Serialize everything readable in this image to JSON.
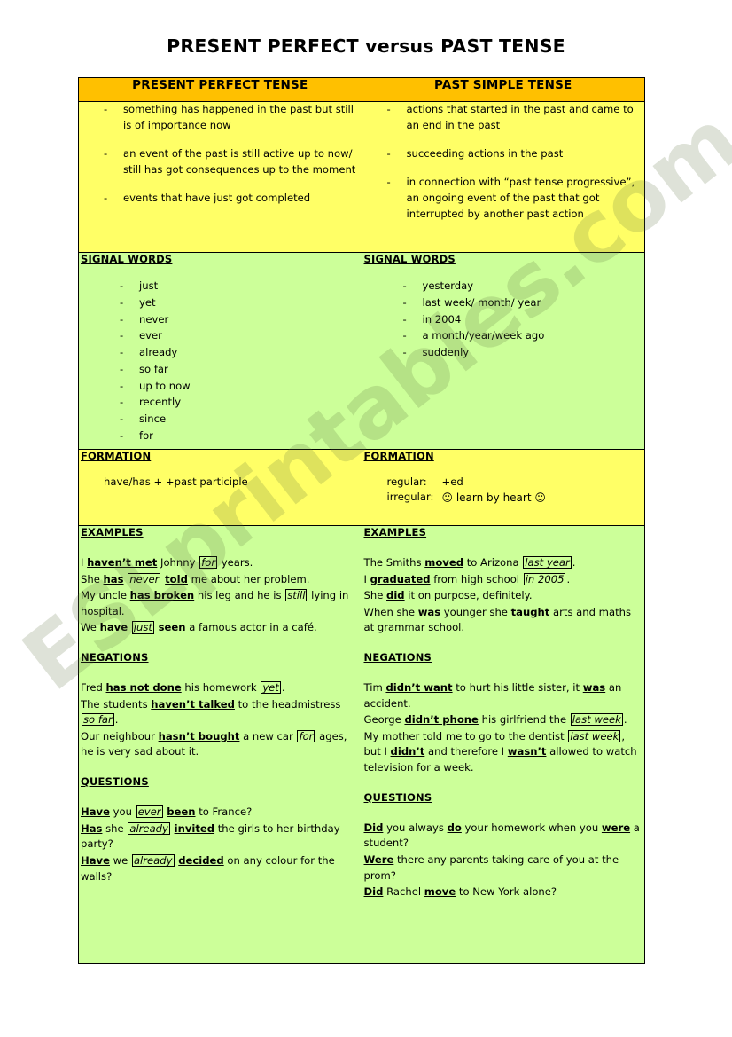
{
  "page_title": "PRESENT PERFECT versus PAST TENSE",
  "watermark": "ESLprintables.com",
  "colors": {
    "header_orange": "#FFC000",
    "row_yellow": "#FFFF66",
    "row_green": "#CCFF99",
    "border": "#000000"
  },
  "table": {
    "headers": {
      "left": "PRESENT PERFECT TENSE",
      "right": "PAST SIMPLE TENSE"
    },
    "definitions": {
      "left": [
        "something has happened in the past but still is of importance now",
        "an event of the past is still active up to now/ still has got consequences up to the moment",
        "events that have just got completed"
      ],
      "right": [
        "actions that started in the past and came to an end in the past",
        "succeeding actions in the past",
        "in connection with “past tense progressive”, an ongoing event of the past that got interrupted by another past action"
      ]
    },
    "signal_words": {
      "heading": "SIGNAL WORDS",
      "left": [
        "just",
        "yet",
        "never",
        "ever",
        "already",
        "so far",
        "up to now",
        "recently",
        "since",
        "for"
      ],
      "right": [
        "yesterday",
        "last week/ month/ year",
        "in 2004",
        "a month/year/week ago",
        "suddenly"
      ]
    },
    "formation": {
      "heading": "FORMATION",
      "left_text": "have/has + +past participle",
      "right_rows": [
        {
          "label": "regular:",
          "value": "+ed"
        },
        {
          "label": "irregular:",
          "value": "☺ learn by heart ☺"
        }
      ]
    },
    "examples": {
      "headings": {
        "examples": "EXAMPLES",
        "negations": "NEGATIONS",
        "questions": "QUESTIONS"
      },
      "left": {
        "examples": [
          "I haven’t met Johnny for years.",
          "She has never told me about her problem.",
          "My uncle has broken his leg and he is still lying in hospital.",
          "We have just seen a famous actor in a café."
        ],
        "negations": [
          "Fred has not done his homework yet.",
          "The students haven’t talked to the headmistress so far.",
          "Our neighbour hasn’t bought a new car for ages, he is very sad about it."
        ],
        "questions": [
          "Have you ever been to France?",
          "Has she already invited the girls to her birthday party?",
          "Have we already decided on any colour for the walls?"
        ]
      },
      "right": {
        "examples": [
          "The Smiths moved to Arizona last year.",
          "I graduated from high school in 2005.",
          "She did it on purpose, definitely.",
          "When she was younger she taught arts and maths at grammar school."
        ],
        "negations": [
          "Tim didn’t want to hurt his little sister, it was an accident.",
          "George didn’t phone his girlfriend the last week.",
          "My mother told me to go to the dentist last week, but I didn’t and therefore I wasn’t allowed to watch television for a week."
        ],
        "questions": [
          "Did you always do your homework when you were a student?",
          "Were there any parents taking care of you at the prom?",
          "Did Rachel move to New York alone?"
        ]
      }
    }
  }
}
